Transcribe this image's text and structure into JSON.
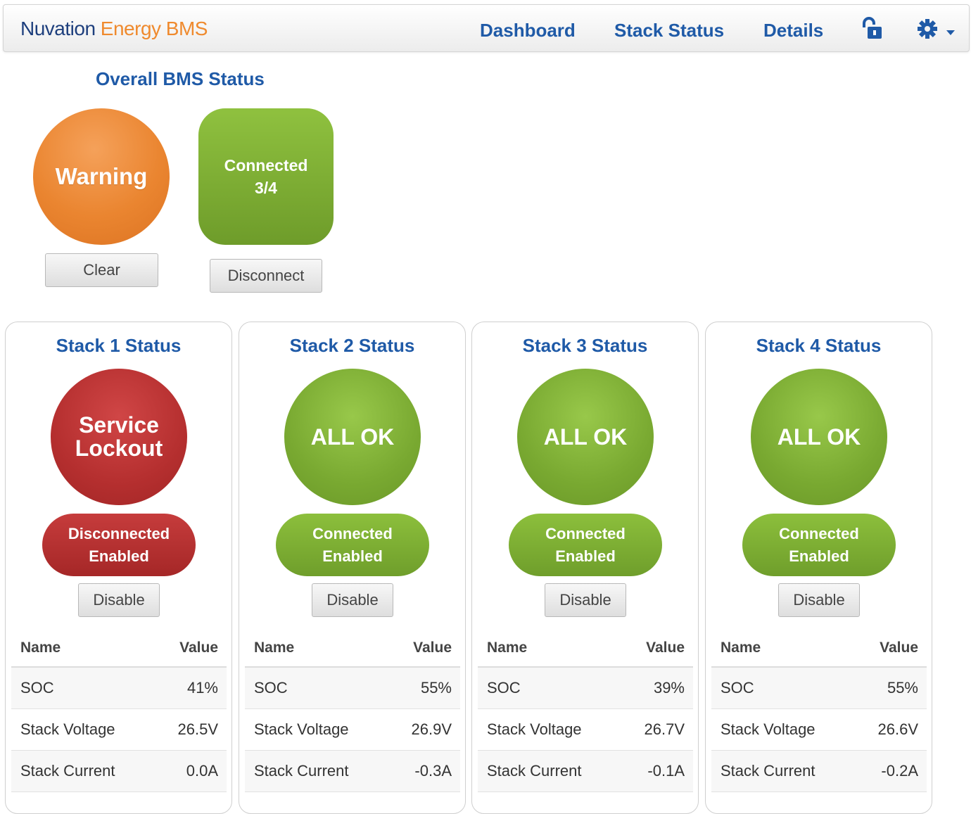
{
  "header": {
    "brand_primary": "Nuvation",
    "brand_secondary": "Energy BMS",
    "nav": [
      {
        "label": "Dashboard"
      },
      {
        "label": "Stack Status"
      },
      {
        "label": "Details"
      }
    ],
    "icons": [
      "unlock-icon",
      "gear-icon",
      "caret-down-icon"
    ]
  },
  "overall": {
    "title": "Overall BMS Status",
    "status_label": "Warning",
    "status_color": "#ea8530",
    "connection_line1": "Connected",
    "connection_line2": "3/4",
    "connection_color": "#7fae33",
    "clear_button": "Clear",
    "disconnect_button": "Disconnect"
  },
  "table_headers": {
    "name": "Name",
    "value": "Value"
  },
  "stacks": [
    {
      "title": "Stack 1 Status",
      "status": "Service\nLockout",
      "status_color": "#b52f2f",
      "pill_line1": "Disconnected",
      "pill_line2": "Enabled",
      "button": "Disable",
      "rows": [
        {
          "name": "SOC",
          "value": "41%"
        },
        {
          "name": "Stack Voltage",
          "value": "26.5V"
        },
        {
          "name": "Stack Current",
          "value": "0.0A"
        }
      ]
    },
    {
      "title": "Stack 2 Status",
      "status": "ALL OK",
      "status_color": "#79a931",
      "pill_line1": "Connected",
      "pill_line2": "Enabled",
      "button": "Disable",
      "rows": [
        {
          "name": "SOC",
          "value": "55%"
        },
        {
          "name": "Stack Voltage",
          "value": "26.9V"
        },
        {
          "name": "Stack Current",
          "value": "-0.3A"
        }
      ]
    },
    {
      "title": "Stack 3 Status",
      "status": "ALL OK",
      "status_color": "#79a931",
      "pill_line1": "Connected",
      "pill_line2": "Enabled",
      "button": "Disable",
      "rows": [
        {
          "name": "SOC",
          "value": "39%"
        },
        {
          "name": "Stack Voltage",
          "value": "26.7V"
        },
        {
          "name": "Stack Current",
          "value": "-0.1A"
        }
      ]
    },
    {
      "title": "Stack 4 Status",
      "status": "ALL OK",
      "status_color": "#79a931",
      "pill_line1": "Connected",
      "pill_line2": "Enabled",
      "button": "Disable",
      "rows": [
        {
          "name": "SOC",
          "value": "55%"
        },
        {
          "name": "Stack Voltage",
          "value": "26.6V"
        },
        {
          "name": "Stack Current",
          "value": "-0.2A"
        }
      ]
    }
  ]
}
